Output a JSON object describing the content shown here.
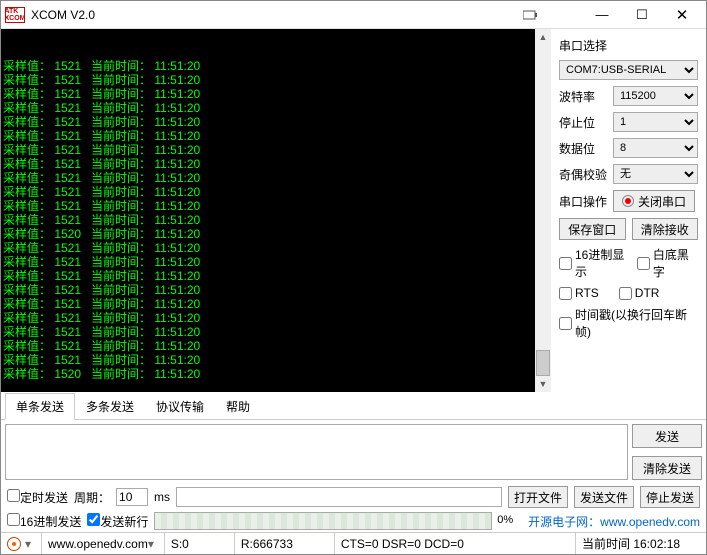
{
  "window": {
    "title": "XCOM V2.0",
    "logo": "ATK XCOM"
  },
  "terminal": {
    "lines": [
      {
        "sample": "采样值： 1521",
        "time": "当前时间： 11:51:20"
      },
      {
        "sample": "采样值： 1521",
        "time": "当前时间： 11:51:20"
      },
      {
        "sample": "采样值： 1521",
        "time": "当前时间： 11:51:20"
      },
      {
        "sample": "采样值： 1521",
        "time": "当前时间： 11:51:20"
      },
      {
        "sample": "采样值： 1521",
        "time": "当前时间： 11:51:20"
      },
      {
        "sample": "采样值： 1521",
        "time": "当前时间： 11:51:20"
      },
      {
        "sample": "采样值： 1521",
        "time": "当前时间： 11:51:20"
      },
      {
        "sample": "采样值： 1521",
        "time": "当前时间： 11:51:20"
      },
      {
        "sample": "采样值： 1521",
        "time": "当前时间： 11:51:20"
      },
      {
        "sample": "采样值： 1521",
        "time": "当前时间： 11:51:20"
      },
      {
        "sample": "采样值： 1521",
        "time": "当前时间： 11:51:20"
      },
      {
        "sample": "采样值： 1521",
        "time": "当前时间： 11:51:20"
      },
      {
        "sample": "采样值： 1520",
        "time": "当前时间： 11:51:20"
      },
      {
        "sample": "采样值： 1521",
        "time": "当前时间： 11:51:20"
      },
      {
        "sample": "采样值： 1521",
        "time": "当前时间： 11:51:20"
      },
      {
        "sample": "采样值： 1521",
        "time": "当前时间： 11:51:20"
      },
      {
        "sample": "采样值： 1521",
        "time": "当前时间： 11:51:20"
      },
      {
        "sample": "采样值： 1521",
        "time": "当前时间： 11:51:20"
      },
      {
        "sample": "采样值： 1521",
        "time": "当前时间： 11:51:20"
      },
      {
        "sample": "采样值： 1521",
        "time": "当前时间： 11:51:20"
      },
      {
        "sample": "采样值： 1521",
        "time": "当前时间： 11:51:20"
      },
      {
        "sample": "采样值： 1521",
        "time": "当前时间： 11:51:20"
      },
      {
        "sample": "采样值： 1520",
        "time": "当前时间： 11:51:20"
      }
    ]
  },
  "side": {
    "port_label": "串口选择",
    "port_value": "COM7:USB-SERIAL",
    "baud_label": "波特率",
    "baud_value": "115200",
    "stop_label": "停止位",
    "stop_value": "1",
    "data_label": "数据位",
    "data_value": "8",
    "parity_label": "奇偶校验",
    "parity_value": "无",
    "op_label": "串口操作",
    "close_btn": "关闭串口",
    "save_window": "保存窗口",
    "clear_recv": "清除接收",
    "hex_display": "16进制显示",
    "white_bg": "白底黑字",
    "rts": "RTS",
    "dtr": "DTR",
    "timestamp": "时间戳(以换行回车断帧)"
  },
  "tabs": {
    "t0": "单条发送",
    "t1": "多条发送",
    "t2": "协议传输",
    "t3": "帮助"
  },
  "send": {
    "send_btn": "发送",
    "clear_btn": "清除发送",
    "timed_send": "定时发送",
    "period_label": "周期：",
    "period_value": "10",
    "period_unit": "ms",
    "open_file": "打开文件",
    "send_file": "发送文件",
    "stop_send": "停止发送",
    "hex_send": "16进制发送",
    "send_newline": "发送新行",
    "progress_pct": "0%",
    "link_text": "开源电子网：www.openedv.com"
  },
  "status": {
    "url": "www.openedv.com",
    "s": "S:0",
    "r": "R:666733",
    "cts": "CTS=0 DSR=0 DCD=0",
    "time": "当前时间 16:02:18"
  }
}
